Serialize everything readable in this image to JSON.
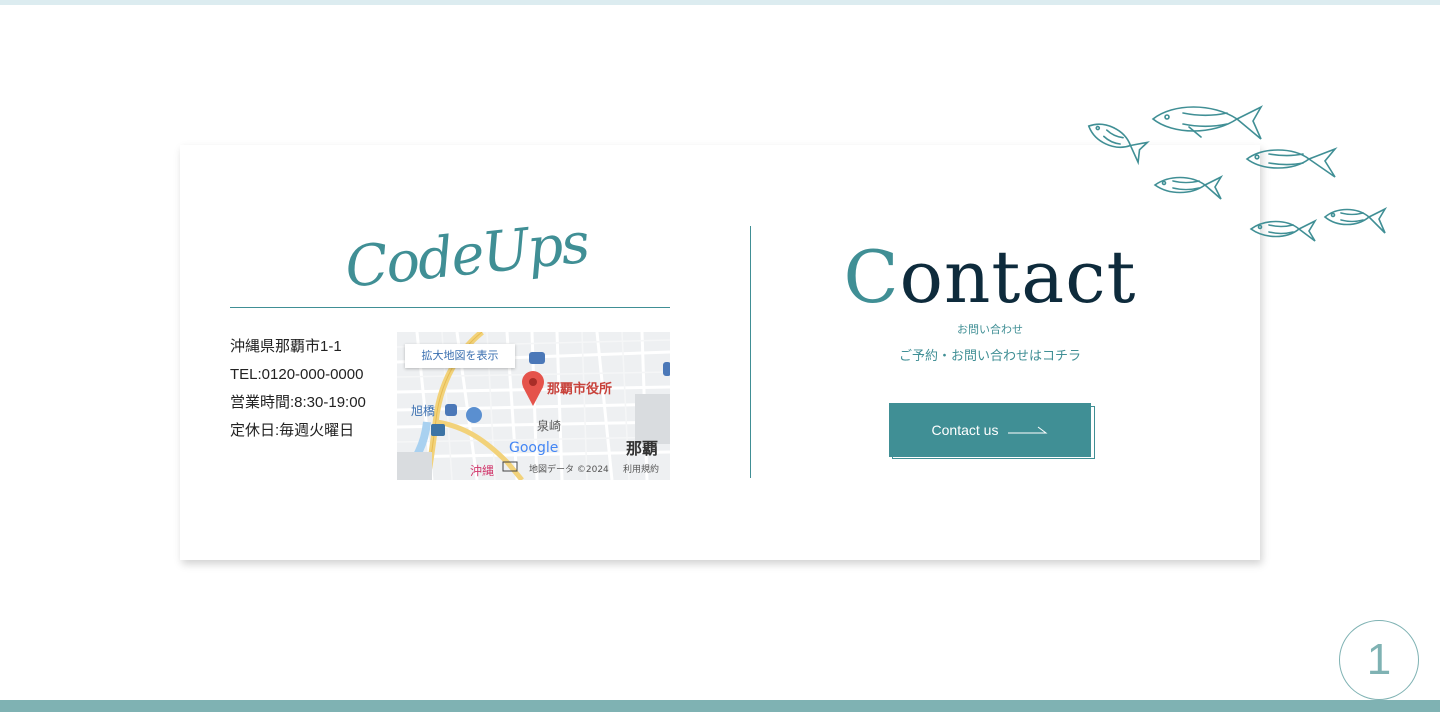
{
  "brand": {
    "logo_text": "CodeUps"
  },
  "info": {
    "address": "沖縄県那覇市1-1",
    "tel": "TEL:0120-000-0000",
    "hours": "営業時間:8:30-19:00",
    "closed": "定休日:毎週火曜日"
  },
  "map": {
    "expand_button": "拡大地図を表示",
    "place_name": "那覇市役所",
    "area_1": "旭橋",
    "area_2": "泉崎",
    "area_3": "那覇",
    "area_4": "沖縄",
    "brand": "Google",
    "credit": "地図データ ©2024",
    "terms": "利用規約"
  },
  "contact": {
    "title_first": "C",
    "title_rest": "ontact",
    "subtitle": "お問い合わせ",
    "description": "ご予約・お問い合わせはコチラ",
    "button_label": "Contact us"
  },
  "page_indicator": "1",
  "colors": {
    "accent": "#408f95",
    "dark_text": "#0e2b3c",
    "bottom_bar": "#7fb2b3"
  }
}
